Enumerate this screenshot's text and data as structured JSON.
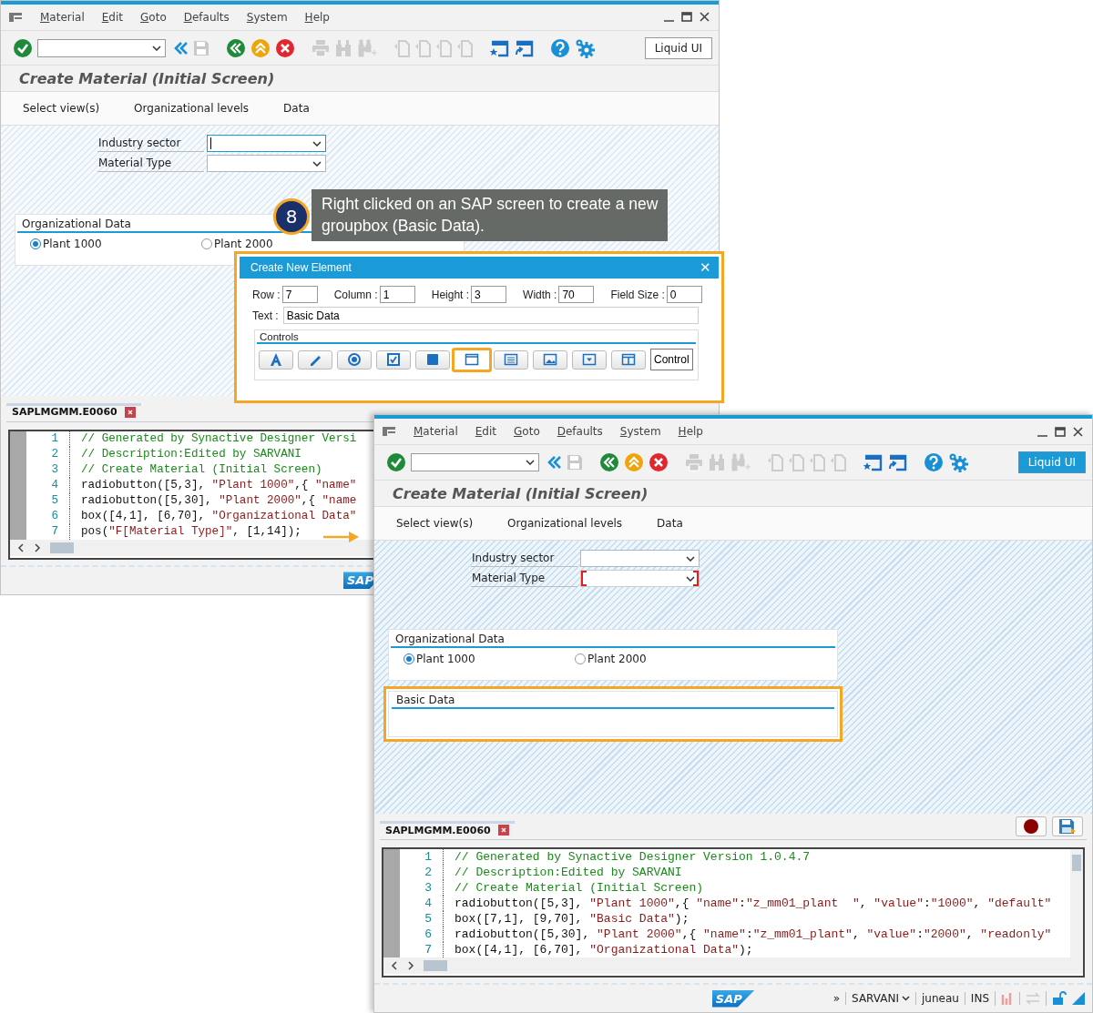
{
  "windows": [
    {
      "menu": [
        "Material",
        "Edit",
        "Goto",
        "Defaults",
        "System",
        "Help"
      ],
      "liquid_ui": {
        "label": "Liquid UI",
        "active": false
      },
      "title": "Create Material (Initial Screen)",
      "app_toolbar": [
        "Select view(s)",
        "Organizational levels",
        "Data"
      ],
      "fields": [
        {
          "label": "Industry sector",
          "focused": true,
          "marked": false
        },
        {
          "label": "Material Type",
          "focused": false,
          "marked": false
        }
      ],
      "groups": [
        {
          "title": "Organizational Data",
          "highlighted": false,
          "radios": [
            {
              "label": "Plant 1000",
              "selected": true
            },
            {
              "label": "Plant 2000",
              "selected": false
            }
          ]
        }
      ],
      "editor": {
        "tab": "SAPLMGMM.E0060",
        "lines": [
          {
            "number": "1",
            "parts": [
              {
                "kind": "comment",
                "text": "// Generated by Synactive Designer Versi"
              }
            ]
          },
          {
            "number": "2",
            "parts": [
              {
                "kind": "comment",
                "text": "// Description:Edited by SARVANI"
              }
            ]
          },
          {
            "number": "3",
            "parts": [
              {
                "kind": "comment",
                "text": "// Create Material (Initial Screen)"
              }
            ]
          },
          {
            "number": "4",
            "parts": [
              {
                "kind": "plain",
                "text": "radiobutton([5,3], "
              },
              {
                "kind": "string",
                "text": "\"Plant 1000\""
              },
              {
                "kind": "plain",
                "text": ",{ "
              },
              {
                "kind": "string",
                "text": "\"name\""
              }
            ]
          },
          {
            "number": "5",
            "parts": [
              {
                "kind": "plain",
                "text": "radiobutton([5,30], "
              },
              {
                "kind": "string",
                "text": "\"Plant 2000\""
              },
              {
                "kind": "plain",
                "text": ",{ "
              },
              {
                "kind": "string",
                "text": "\"name"
              }
            ]
          },
          {
            "number": "6",
            "parts": [
              {
                "kind": "plain",
                "text": "box([4,1], [6,70], "
              },
              {
                "kind": "string",
                "text": "\"Organizational Data\""
              }
            ]
          },
          {
            "number": "7",
            "parts": [
              {
                "kind": "plain",
                "text": "pos("
              },
              {
                "kind": "string",
                "text": "\"F[Material Type]\""
              },
              {
                "kind": "plain",
                "text": ", [1,14]);"
              }
            ]
          }
        ]
      },
      "status": {
        "logo": "SAP"
      }
    },
    {
      "menu": [
        "Material",
        "Edit",
        "Goto",
        "Defaults",
        "System",
        "Help"
      ],
      "liquid_ui": {
        "label": "Liquid UI",
        "active": true
      },
      "title": "Create Material (Initial Screen)",
      "app_toolbar": [
        "Select view(s)",
        "Organizational levels",
        "Data"
      ],
      "fields": [
        {
          "label": "Industry sector",
          "focused": false,
          "marked": false
        },
        {
          "label": "Material Type",
          "focused": false,
          "marked": true
        }
      ],
      "groups": [
        {
          "title": "Organizational Data",
          "highlighted": false,
          "radios": [
            {
              "label": "Plant 1000",
              "selected": true
            },
            {
              "label": "Plant 2000",
              "selected": false
            }
          ]
        },
        {
          "title": "Basic Data",
          "highlighted": true
        }
      ],
      "editor": {
        "tab": "SAPLMGMM.E0060",
        "tools": [
          {
            "kind": "record"
          },
          {
            "kind": "save"
          }
        ],
        "lines": [
          {
            "number": "1",
            "parts": [
              {
                "kind": "comment",
                "text": "// Generated by Synactive Designer Version 1.0.4.7"
              }
            ]
          },
          {
            "number": "2",
            "parts": [
              {
                "kind": "comment",
                "text": "// Description:Edited by SARVANI"
              }
            ]
          },
          {
            "number": "3",
            "parts": [
              {
                "kind": "comment",
                "text": "// Create Material (Initial Screen)"
              }
            ]
          },
          {
            "number": "4",
            "parts": [
              {
                "kind": "plain",
                "text": "radiobutton([5,3], "
              },
              {
                "kind": "string",
                "text": "\"Plant 1000\""
              },
              {
                "kind": "plain",
                "text": ",{ "
              },
              {
                "kind": "string",
                "text": "\"name\""
              },
              {
                "kind": "plain",
                "text": ":"
              },
              {
                "kind": "string",
                "text": "\"z_mm01_plant  \""
              },
              {
                "kind": "plain",
                "text": ", "
              },
              {
                "kind": "string",
                "text": "\"value\""
              },
              {
                "kind": "plain",
                "text": ":"
              },
              {
                "kind": "string",
                "text": "\"1000\""
              },
              {
                "kind": "plain",
                "text": ", "
              },
              {
                "kind": "string",
                "text": "\"default\""
              }
            ]
          },
          {
            "number": "5",
            "parts": [
              {
                "kind": "plain",
                "text": "box([7,1], [9,70], "
              },
              {
                "kind": "string",
                "text": "\"Basic Data\""
              },
              {
                "kind": "plain",
                "text": ");"
              }
            ]
          },
          {
            "number": "6",
            "parts": [
              {
                "kind": "plain",
                "text": "radiobutton([5,30], "
              },
              {
                "kind": "string",
                "text": "\"Plant 2000\""
              },
              {
                "kind": "plain",
                "text": ",{ "
              },
              {
                "kind": "string",
                "text": "\"name\""
              },
              {
                "kind": "plain",
                "text": ":"
              },
              {
                "kind": "string",
                "text": "\"z_mm01_plant\""
              },
              {
                "kind": "plain",
                "text": ", "
              },
              {
                "kind": "string",
                "text": "\"value\""
              },
              {
                "kind": "plain",
                "text": ":"
              },
              {
                "kind": "string",
                "text": "\"2000\""
              },
              {
                "kind": "plain",
                "text": ", "
              },
              {
                "kind": "string",
                "text": "\"readonly\""
              }
            ]
          },
          {
            "number": "7",
            "parts": [
              {
                "kind": "plain",
                "text": "box([4,1], [6,70], "
              },
              {
                "kind": "string",
                "text": "\"Organizational Data\""
              },
              {
                "kind": "plain",
                "text": ");"
              }
            ]
          }
        ]
      },
      "status": {
        "logo": "SAP",
        "expander": "»",
        "user": "SARVANI",
        "server": "juneau",
        "mode": "INS"
      }
    }
  ],
  "callout": {
    "number": "8",
    "text": "Right clicked on an SAP screen to create a new groupbox (Basic Data)."
  },
  "dialog": {
    "title": "Create New Element",
    "close": "✕",
    "fields": [
      {
        "label": "Row :",
        "value": "7"
      },
      {
        "label": "Column :",
        "value": "1"
      },
      {
        "label": "Height :",
        "value": "3"
      },
      {
        "label": "Width :",
        "value": "70"
      },
      {
        "label": "Field Size :",
        "value": "0"
      }
    ],
    "text_field": {
      "label": "Text :",
      "value": "Basic Data"
    },
    "controls_title": "Controls",
    "controls": [
      {
        "kind": "text",
        "selected": false
      },
      {
        "kind": "pen",
        "selected": false
      },
      {
        "kind": "radio",
        "selected": false
      },
      {
        "kind": "checkbox",
        "selected": false
      },
      {
        "kind": "square",
        "selected": false
      },
      {
        "kind": "groupbox",
        "selected": true
      },
      {
        "kind": "list",
        "selected": false
      },
      {
        "kind": "image",
        "selected": false
      },
      {
        "kind": "dropdown",
        "selected": false
      },
      {
        "kind": "table",
        "selected": false
      },
      {
        "kind": "label",
        "label": "Control",
        "selected": false
      }
    ]
  }
}
